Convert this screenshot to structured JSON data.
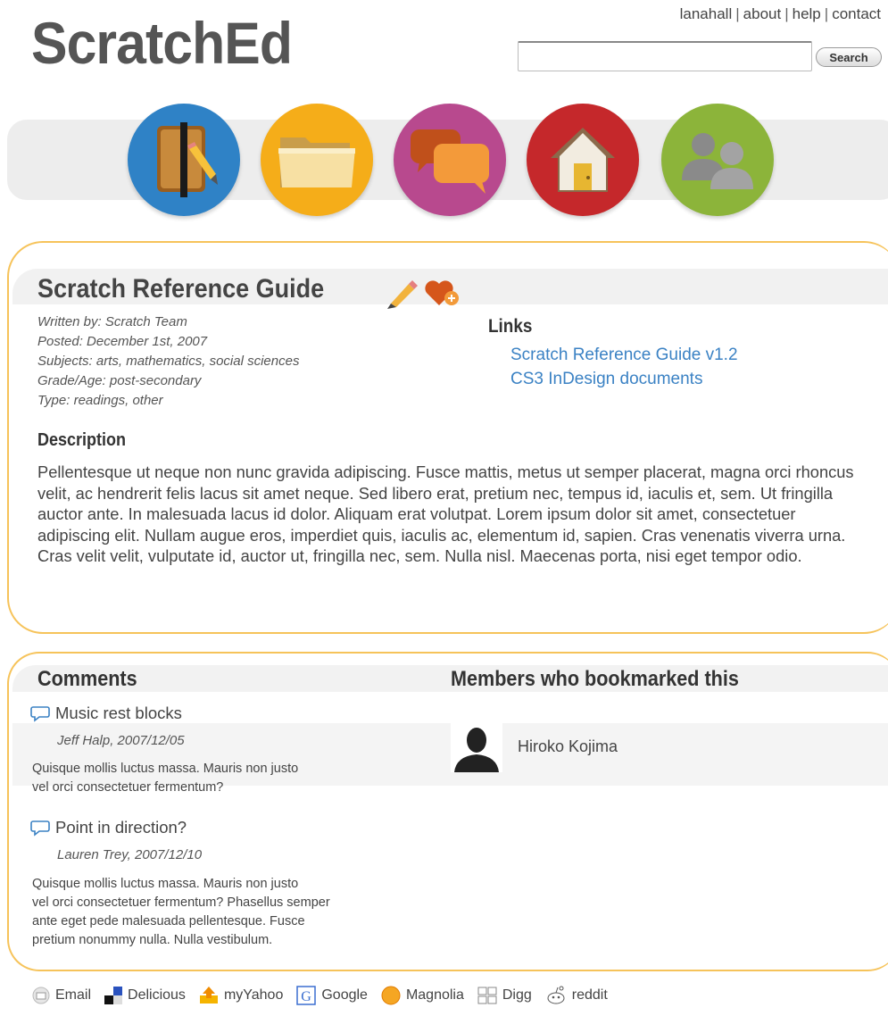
{
  "header": {
    "logo": "ScratchEd",
    "links": [
      "lanahall",
      "about",
      "help",
      "contact"
    ],
    "search_button": "Search"
  },
  "nav": {
    "icons": [
      "notebook-pencil-icon",
      "folder-icon",
      "chat-bubbles-icon",
      "home-icon",
      "people-icon"
    ],
    "colors": [
      "#2f82c6",
      "#f5ad19",
      "#b8498e",
      "#c5282b",
      "#8cb43a"
    ]
  },
  "resource": {
    "title": "Scratch Reference Guide",
    "meta": [
      "Written by: Scratch Team",
      "Posted: December 1st, 2007",
      "Subjects: arts, mathematics, social sciences",
      "Grade/Age: post-secondary",
      "Type: readings, other"
    ],
    "links_heading": "Links",
    "links": [
      "Scratch Reference Guide v1.2",
      "CS3 InDesign documents"
    ],
    "description_heading": "Description",
    "description": "Pellentesque ut neque non nunc gravida adipiscing. Fusce mattis, metus ut semper placerat, magna orci rhoncus velit, ac hendrerit felis lacus sit amet neque. Sed libero erat, pretium nec, tempus id, iaculis et, sem. Ut fringilla auctor ante. In malesuada lacus id dolor. Aliquam erat volutpat. Lorem ipsum dolor sit amet, consectetuer adipiscing elit. Nullam augue eros, imperdiet quis, iaculis ac, elementum id, sapien. Cras venenatis viverra urna. Cras velit velit, vulputate id, auctor ut, fringilla nec, sem. Nulla nisl. Maecenas porta, nisi eget tempor odio."
  },
  "comments": {
    "heading": "Comments",
    "items": [
      {
        "title": "Music rest blocks",
        "byline": "Jeff Halp, 2007/12/05",
        "body": [
          "Quisque mollis luctus massa. Mauris non justo",
          "vel orci consectetuer fermentum?"
        ]
      },
      {
        "title": "Point in direction?",
        "byline": "Lauren Trey, 2007/12/10",
        "body": [
          "Quisque mollis luctus massa. Mauris non justo",
          "vel orci consectetuer fermentum? Phasellus semper",
          "ante eget pede malesuada pellentesque. Fusce",
          "pretium nonummy nulla. Nulla vestibulum."
        ]
      }
    ]
  },
  "members": {
    "heading": "Members who bookmarked this",
    "items": [
      {
        "name": "Hiroko Kojima"
      }
    ]
  },
  "footer": {
    "items": [
      "Email",
      "Delicious",
      "myYahoo",
      "Google",
      "Magnolia",
      "Digg",
      "reddit"
    ]
  }
}
